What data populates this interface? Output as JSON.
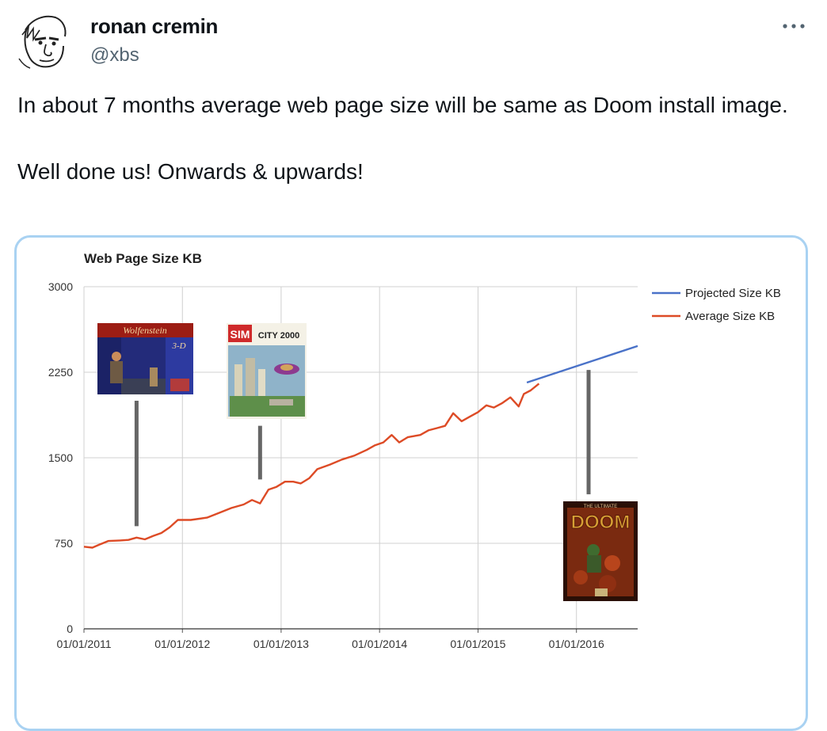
{
  "tweet": {
    "author_name": "ronan cremin",
    "author_handle": "@xbs",
    "more_icon": "more-horizontal-icon",
    "text_paragraphs": [
      "In about 7 months average web page size will be same as Doom install image.",
      "Well done us! Onwards & upwards!"
    ]
  },
  "chart_data": {
    "type": "line",
    "title": "Web Page Size KB",
    "xlabel": "",
    "ylabel": "",
    "ylim": [
      0,
      3000
    ],
    "yticks": [
      "0",
      "750",
      "1500",
      "2250",
      "3000"
    ],
    "xticks": [
      "01/01/2011",
      "01/01/2012",
      "01/01/2013",
      "01/01/2014",
      "01/01/2015",
      "01/01/2016"
    ],
    "xlim": [
      "2011-01-01",
      "2016-08-15"
    ],
    "grid": true,
    "legend_position": "right",
    "series": [
      {
        "name": "Projected Size KB",
        "color": "#4a72c8",
        "points": [
          [
            "2015-07-01",
            2160
          ],
          [
            "2016-08-15",
            2480
          ]
        ]
      },
      {
        "name": "Average Size KB",
        "color": "#dd4b26",
        "points": [
          [
            "2011-01-01",
            720
          ],
          [
            "2011-02-01",
            712
          ],
          [
            "2011-03-01",
            740
          ],
          [
            "2011-04-01",
            770
          ],
          [
            "2011-05-15",
            775
          ],
          [
            "2011-06-15",
            780
          ],
          [
            "2011-07-15",
            800
          ],
          [
            "2011-08-15",
            785
          ],
          [
            "2011-09-15",
            815
          ],
          [
            "2011-10-15",
            840
          ],
          [
            "2011-11-15",
            890
          ],
          [
            "2011-12-15",
            955
          ],
          [
            "2012-02-01",
            955
          ],
          [
            "2012-04-01",
            975
          ],
          [
            "2012-05-15",
            1015
          ],
          [
            "2012-07-01",
            1060
          ],
          [
            "2012-08-15",
            1090
          ],
          [
            "2012-09-15",
            1130
          ],
          [
            "2012-10-15",
            1100
          ],
          [
            "2012-11-15",
            1220
          ],
          [
            "2012-12-15",
            1245
          ],
          [
            "2013-01-15",
            1290
          ],
          [
            "2013-02-15",
            1290
          ],
          [
            "2013-03-15",
            1275
          ],
          [
            "2013-04-15",
            1320
          ],
          [
            "2013-05-15",
            1400
          ],
          [
            "2013-07-01",
            1440
          ],
          [
            "2013-08-15",
            1485
          ],
          [
            "2013-10-01",
            1520
          ],
          [
            "2013-11-15",
            1570
          ],
          [
            "2013-12-15",
            1610
          ],
          [
            "2014-01-15",
            1635
          ],
          [
            "2014-02-15",
            1700
          ],
          [
            "2014-03-15",
            1635
          ],
          [
            "2014-04-15",
            1680
          ],
          [
            "2014-06-01",
            1700
          ],
          [
            "2014-07-01",
            1740
          ],
          [
            "2014-08-01",
            1760
          ],
          [
            "2014-09-01",
            1780
          ],
          [
            "2014-10-01",
            1890
          ],
          [
            "2014-11-01",
            1820
          ],
          [
            "2014-12-01",
            1860
          ],
          [
            "2015-01-01",
            1900
          ],
          [
            "2015-02-01",
            1960
          ],
          [
            "2015-03-01",
            1940
          ],
          [
            "2015-04-01",
            1980
          ],
          [
            "2015-05-01",
            2030
          ],
          [
            "2015-06-01",
            1950
          ],
          [
            "2015-06-20",
            2060
          ],
          [
            "2015-07-15",
            2090
          ],
          [
            "2015-08-15",
            2150
          ]
        ]
      }
    ],
    "annotations": [
      {
        "kind": "game-cover",
        "label": "Wolfenstein 3-D",
        "marker_date": "2011-07-15",
        "marker_from": 2000,
        "marker_to": 900
      },
      {
        "kind": "game-cover",
        "label": "SIM CITY 2000",
        "marker_date": "2012-10-15",
        "marker_from": 1780,
        "marker_to": 1310
      },
      {
        "kind": "game-cover",
        "label": "The Ultimate DOOM",
        "marker_date": "2016-02-15",
        "marker_from": 2270,
        "marker_to": 1180
      }
    ]
  }
}
